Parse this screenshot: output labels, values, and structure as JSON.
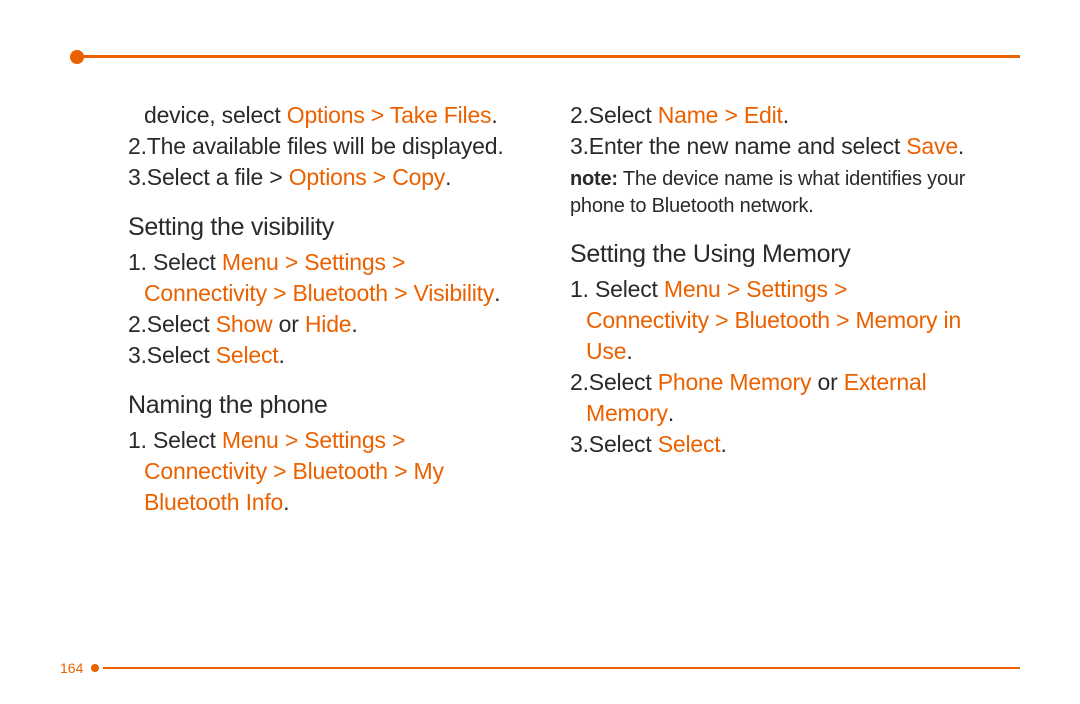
{
  "page_number": "164",
  "accent": "#eb6100",
  "left": {
    "intro_steps": [
      {
        "pre": "device, select ",
        "kw": "Options > Take Files",
        "post": "."
      },
      {
        "num": "2.",
        "pre": "The available files will be displayed."
      },
      {
        "num": "3.",
        "pre": "Select a file > ",
        "kw": "Options > Copy",
        "post": "."
      }
    ],
    "sec1_title": "Setting the visibility",
    "sec1_steps": [
      {
        "num": "1. ",
        "pre": "Select ",
        "kw": "Menu > Settings > Connectivity > Bluetooth > Visibility",
        "post": "."
      },
      {
        "num": "2.",
        "pre": "Select ",
        "kw": "Show",
        "mid": " or ",
        "kw2": "Hide",
        "post": "."
      },
      {
        "num": "3.",
        "pre": "Select ",
        "kw": "Select",
        "post": "."
      }
    ],
    "sec2_title": "Naming the phone",
    "sec2_steps": [
      {
        "num": "1. ",
        "pre": "Select ",
        "kw": "Menu > Settings > Connectivity > Bluetooth > My Bluetooth Info",
        "post": "."
      }
    ]
  },
  "right": {
    "cont_steps": [
      {
        "num": "2.",
        "pre": "Select ",
        "kw": "Name > Edit",
        "post": "."
      },
      {
        "num": "3.",
        "pre": "Enter the new name and select ",
        "kw": "Save",
        "post": "."
      }
    ],
    "note_bold": "note:",
    "note_text": " The device name is what identifies your phone to Bluetooth network.",
    "sec1_title": "Setting the Using Memory",
    "sec1_steps": [
      {
        "num": "1. ",
        "pre": "Select ",
        "kw": "Menu > Settings > Connectivity > Bluetooth > Memory in Use",
        "post": "."
      },
      {
        "num": "2.",
        "pre": "Select ",
        "kw": "Phone Memory",
        "mid": " or ",
        "kw2": "External Memory",
        "post": "."
      },
      {
        "num": "3.",
        "pre": "Select ",
        "kw": "Select",
        "post": "."
      }
    ]
  }
}
